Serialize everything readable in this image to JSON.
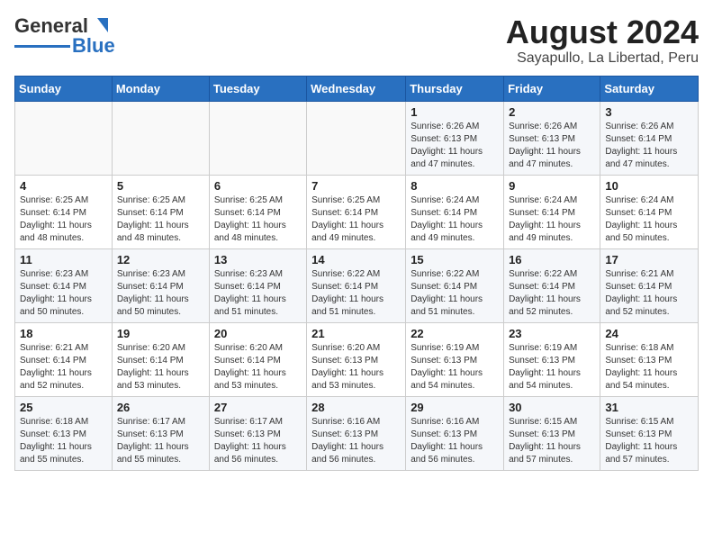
{
  "header": {
    "logo_general": "General",
    "logo_blue": "Blue",
    "month_title": "August 2024",
    "location": "Sayapullo, La Libertad, Peru"
  },
  "days_of_week": [
    "Sunday",
    "Monday",
    "Tuesday",
    "Wednesday",
    "Thursday",
    "Friday",
    "Saturday"
  ],
  "weeks": [
    [
      {
        "day": "",
        "info": ""
      },
      {
        "day": "",
        "info": ""
      },
      {
        "day": "",
        "info": ""
      },
      {
        "day": "",
        "info": ""
      },
      {
        "day": "1",
        "info": "Sunrise: 6:26 AM\nSunset: 6:13 PM\nDaylight: 11 hours and 47 minutes."
      },
      {
        "day": "2",
        "info": "Sunrise: 6:26 AM\nSunset: 6:13 PM\nDaylight: 11 hours and 47 minutes."
      },
      {
        "day": "3",
        "info": "Sunrise: 6:26 AM\nSunset: 6:14 PM\nDaylight: 11 hours and 47 minutes."
      }
    ],
    [
      {
        "day": "4",
        "info": "Sunrise: 6:25 AM\nSunset: 6:14 PM\nDaylight: 11 hours and 48 minutes."
      },
      {
        "day": "5",
        "info": "Sunrise: 6:25 AM\nSunset: 6:14 PM\nDaylight: 11 hours and 48 minutes."
      },
      {
        "day": "6",
        "info": "Sunrise: 6:25 AM\nSunset: 6:14 PM\nDaylight: 11 hours and 48 minutes."
      },
      {
        "day": "7",
        "info": "Sunrise: 6:25 AM\nSunset: 6:14 PM\nDaylight: 11 hours and 49 minutes."
      },
      {
        "day": "8",
        "info": "Sunrise: 6:24 AM\nSunset: 6:14 PM\nDaylight: 11 hours and 49 minutes."
      },
      {
        "day": "9",
        "info": "Sunrise: 6:24 AM\nSunset: 6:14 PM\nDaylight: 11 hours and 49 minutes."
      },
      {
        "day": "10",
        "info": "Sunrise: 6:24 AM\nSunset: 6:14 PM\nDaylight: 11 hours and 50 minutes."
      }
    ],
    [
      {
        "day": "11",
        "info": "Sunrise: 6:23 AM\nSunset: 6:14 PM\nDaylight: 11 hours and 50 minutes."
      },
      {
        "day": "12",
        "info": "Sunrise: 6:23 AM\nSunset: 6:14 PM\nDaylight: 11 hours and 50 minutes."
      },
      {
        "day": "13",
        "info": "Sunrise: 6:23 AM\nSunset: 6:14 PM\nDaylight: 11 hours and 51 minutes."
      },
      {
        "day": "14",
        "info": "Sunrise: 6:22 AM\nSunset: 6:14 PM\nDaylight: 11 hours and 51 minutes."
      },
      {
        "day": "15",
        "info": "Sunrise: 6:22 AM\nSunset: 6:14 PM\nDaylight: 11 hours and 51 minutes."
      },
      {
        "day": "16",
        "info": "Sunrise: 6:22 AM\nSunset: 6:14 PM\nDaylight: 11 hours and 52 minutes."
      },
      {
        "day": "17",
        "info": "Sunrise: 6:21 AM\nSunset: 6:14 PM\nDaylight: 11 hours and 52 minutes."
      }
    ],
    [
      {
        "day": "18",
        "info": "Sunrise: 6:21 AM\nSunset: 6:14 PM\nDaylight: 11 hours and 52 minutes."
      },
      {
        "day": "19",
        "info": "Sunrise: 6:20 AM\nSunset: 6:14 PM\nDaylight: 11 hours and 53 minutes."
      },
      {
        "day": "20",
        "info": "Sunrise: 6:20 AM\nSunset: 6:14 PM\nDaylight: 11 hours and 53 minutes."
      },
      {
        "day": "21",
        "info": "Sunrise: 6:20 AM\nSunset: 6:13 PM\nDaylight: 11 hours and 53 minutes."
      },
      {
        "day": "22",
        "info": "Sunrise: 6:19 AM\nSunset: 6:13 PM\nDaylight: 11 hours and 54 minutes."
      },
      {
        "day": "23",
        "info": "Sunrise: 6:19 AM\nSunset: 6:13 PM\nDaylight: 11 hours and 54 minutes."
      },
      {
        "day": "24",
        "info": "Sunrise: 6:18 AM\nSunset: 6:13 PM\nDaylight: 11 hours and 54 minutes."
      }
    ],
    [
      {
        "day": "25",
        "info": "Sunrise: 6:18 AM\nSunset: 6:13 PM\nDaylight: 11 hours and 55 minutes."
      },
      {
        "day": "26",
        "info": "Sunrise: 6:17 AM\nSunset: 6:13 PM\nDaylight: 11 hours and 55 minutes."
      },
      {
        "day": "27",
        "info": "Sunrise: 6:17 AM\nSunset: 6:13 PM\nDaylight: 11 hours and 56 minutes."
      },
      {
        "day": "28",
        "info": "Sunrise: 6:16 AM\nSunset: 6:13 PM\nDaylight: 11 hours and 56 minutes."
      },
      {
        "day": "29",
        "info": "Sunrise: 6:16 AM\nSunset: 6:13 PM\nDaylight: 11 hours and 56 minutes."
      },
      {
        "day": "30",
        "info": "Sunrise: 6:15 AM\nSunset: 6:13 PM\nDaylight: 11 hours and 57 minutes."
      },
      {
        "day": "31",
        "info": "Sunrise: 6:15 AM\nSunset: 6:13 PM\nDaylight: 11 hours and 57 minutes."
      }
    ]
  ]
}
